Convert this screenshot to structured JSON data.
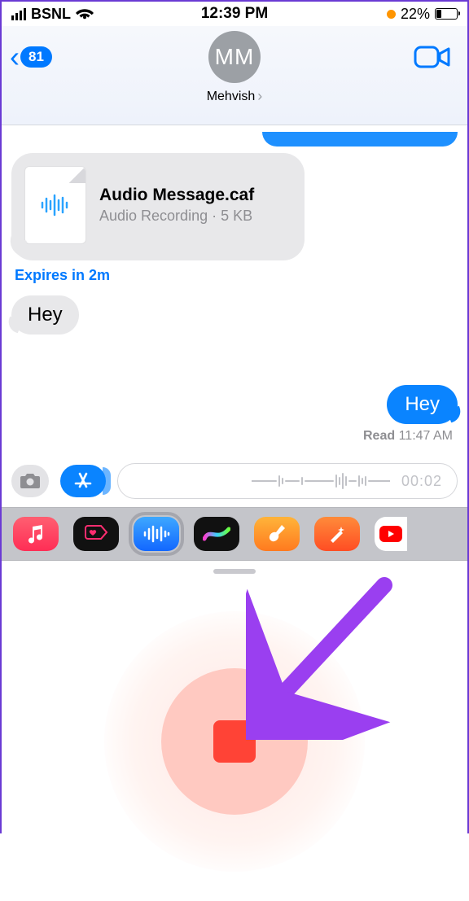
{
  "status": {
    "carrier": "BSNL",
    "time": "12:39 PM",
    "battery_pct": "22%"
  },
  "nav": {
    "back_badge": "81",
    "avatar_initials": "MM",
    "contact_name": "Mehvish"
  },
  "messages": {
    "audio": {
      "file_name": "Audio Message.caf",
      "file_sub": "Audio Recording · 5 KB",
      "expires": "Expires in 2m"
    },
    "incoming_text": "Hey",
    "outgoing_text": "Hey",
    "read_label": "Read",
    "read_time": "11:47 AM"
  },
  "compose": {
    "timer": "00:02"
  },
  "apps": {
    "music": "music-app",
    "fitness": "fitness-app",
    "audio": "audio-message-app",
    "draw": "digital-touch-app",
    "gband": "garageband-app",
    "memoji": "memoji-app",
    "yt": "youtube-app"
  }
}
